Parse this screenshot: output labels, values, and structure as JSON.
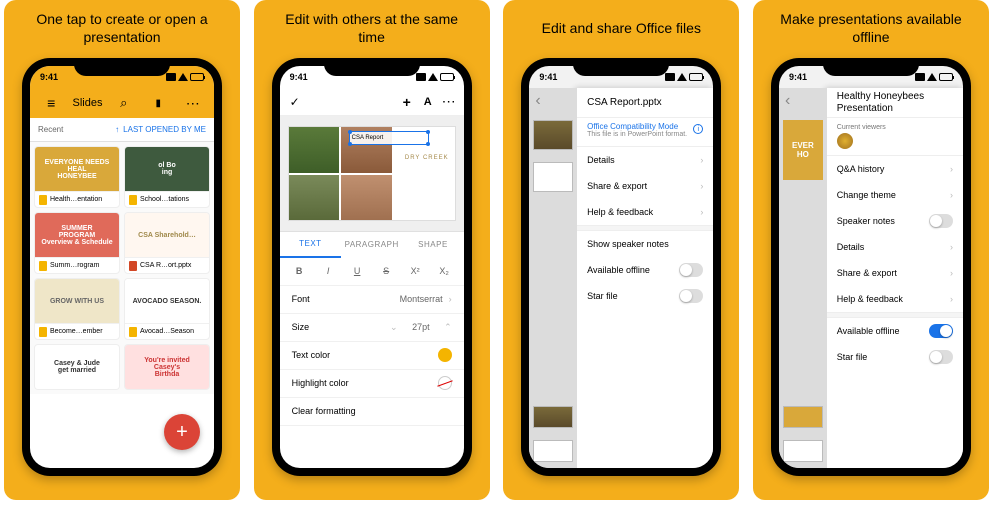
{
  "panels": [
    {
      "caption": "One tap to create or open a presentation"
    },
    {
      "caption": "Edit with others at the same time"
    },
    {
      "caption": "Edit and share Office files"
    },
    {
      "caption": "Make presentations available offline"
    }
  ],
  "status_time": "9:41",
  "p1": {
    "app_title": "Slides",
    "filter_left": "Recent",
    "filter_right": "LAST OPENED BY ME",
    "cards": [
      {
        "thumb_text": "EVERYONE NEEDS HEAL\nHONEYBEE",
        "label": "Health…entation",
        "kind": "slides",
        "bg": "#d9a83a",
        "fg": "#fff"
      },
      {
        "thumb_text": "ol Bo\ning",
        "label": "School…tations",
        "kind": "slides",
        "bg": "#3e5a3e",
        "fg": "#fff"
      },
      {
        "thumb_text": "SUMMER\nPROGRAM\nOverview & Schedule",
        "label": "Summ…rogram",
        "kind": "slides",
        "bg": "#e06a5a",
        "fg": "#fff"
      },
      {
        "thumb_text": "CSA Sharehold…",
        "label": "CSA R…ort.pptx",
        "kind": "ppt",
        "bg": "#fff7f0",
        "fg": "#a0894a"
      },
      {
        "thumb_text": "GROW WITH US",
        "label": "Become…ember",
        "kind": "slides",
        "bg": "#efe6c8",
        "fg": "#666"
      },
      {
        "thumb_text": "AVOCADO SEASON.",
        "label": "Avocad…Season",
        "kind": "slides",
        "bg": "#fff",
        "fg": "#333"
      },
      {
        "thumb_text": "Casey & Jude\nget married",
        "label": "",
        "kind": "slides",
        "bg": "#fff",
        "fg": "#333"
      },
      {
        "thumb_text": "You're invited\nCasey's\nBirthda",
        "label": "",
        "kind": "slides",
        "bg": "#ffe0e0",
        "fg": "#c33"
      }
    ],
    "fab": "+"
  },
  "p2": {
    "slide_title": "CSA Report",
    "slide_brand": "DRY CREEK",
    "tabs": [
      "TEXT",
      "PARAGRAPH",
      "SHAPE"
    ],
    "active_tab": 0,
    "tool_icons": [
      "B",
      "I",
      "U",
      "S",
      "X²",
      "X₂"
    ],
    "rows": {
      "font_label": "Font",
      "font_value": "Montserrat",
      "size_label": "Size",
      "size_value": "27pt",
      "textcolor_label": "Text color",
      "highlight_label": "Highlight color",
      "clear_label": "Clear formatting"
    }
  },
  "p3": {
    "title": "CSA Report.pptx",
    "compat_title": "Office Compatibility Mode",
    "compat_sub": "This file is in PowerPoint format.",
    "items_top": [
      "Details",
      "Share & export",
      "Help & feedback"
    ],
    "speaker": "Show speaker notes",
    "offline": "Available offline",
    "star": "Star file"
  },
  "p4": {
    "title": "Healthy Honeybees Presentation",
    "viewers_label": "Current viewers",
    "items_top": [
      "Q&A history",
      "Change theme",
      "Speaker notes",
      "Details",
      "Share & export",
      "Help & feedback"
    ],
    "offline": "Available offline",
    "star": "Star file",
    "bg_slide_text": "EVER\nHO"
  }
}
